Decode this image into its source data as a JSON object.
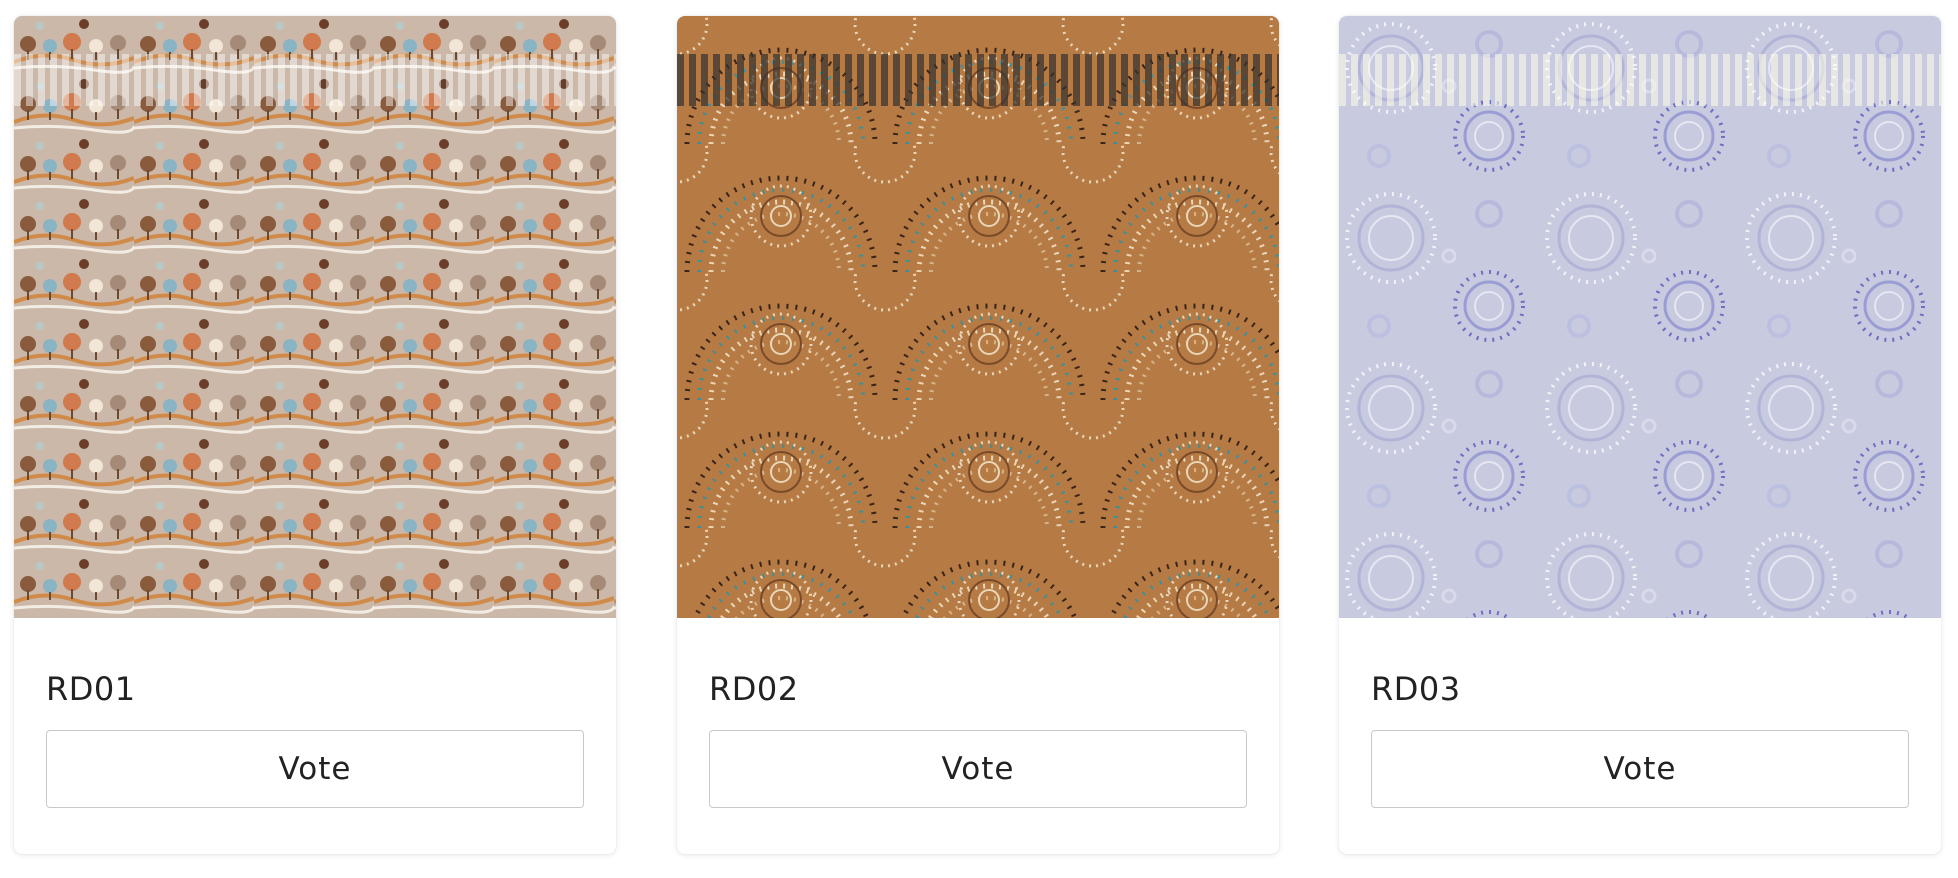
{
  "cards": [
    {
      "code": "RD01",
      "vote_label": "Vote",
      "pattern": "savanna-landscape-pattern",
      "base_color": "#cbb8a8"
    },
    {
      "code": "RD02",
      "vote_label": "Vote",
      "pattern": "dotted-concentric-arcs-pattern",
      "base_color": "#b67a45"
    },
    {
      "code": "RD03",
      "vote_label": "Vote",
      "pattern": "dotted-circles-pattern",
      "base_color": "#c8cadf"
    }
  ]
}
